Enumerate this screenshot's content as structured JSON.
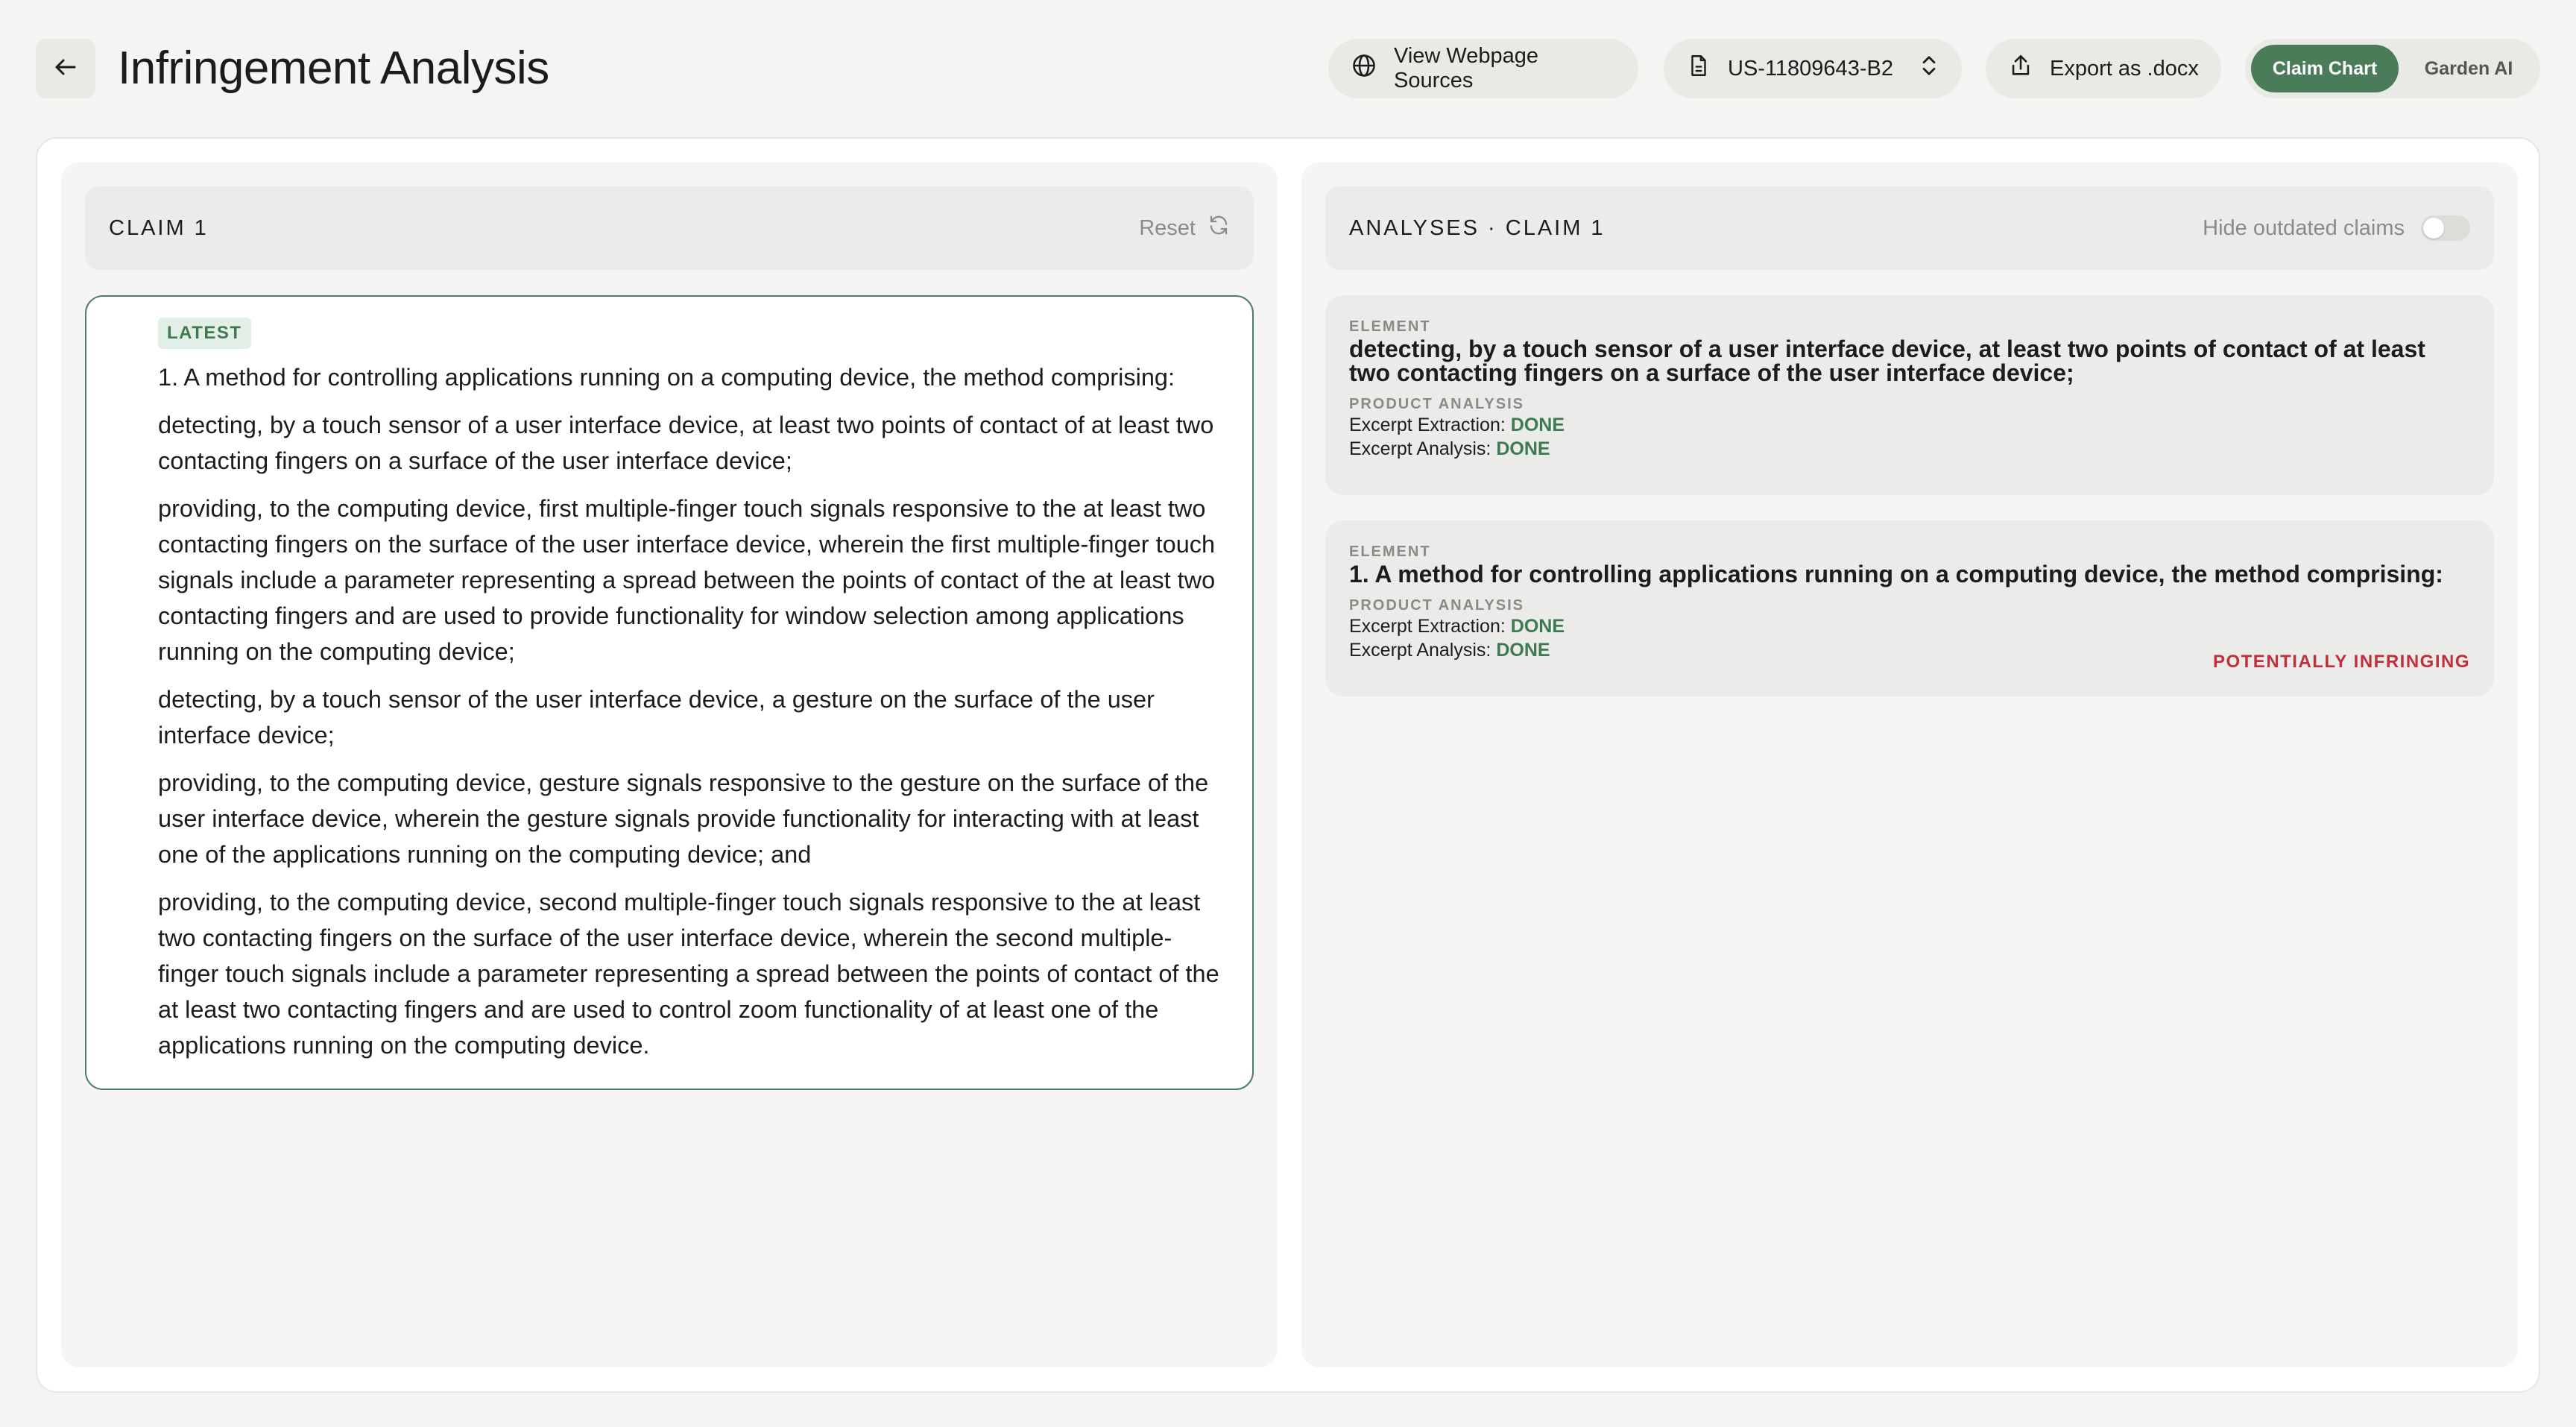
{
  "header": {
    "title": "Infringement Analysis",
    "view_sources_label": "View Webpage Sources",
    "patent_number": "US-11809643-B2",
    "export_label": "Export as .docx",
    "tabs": [
      {
        "label": "Claim Chart",
        "active": true
      },
      {
        "label": "Garden AI",
        "active": false
      }
    ]
  },
  "claim_panel": {
    "title": "CLAIM 1",
    "reset_label": "Reset",
    "badge": "LATEST",
    "paragraphs": [
      "1. A method for controlling applications running on a computing device, the method comprising:",
      "detecting, by a touch sensor of a user interface device, at least two points of contact of at least two contacting fingers on a surface of the user interface device;",
      "providing, to the computing device, first multiple-finger touch signals responsive to the at least two contacting fingers on the surface of the user interface device, wherein the first multiple-finger touch signals include a parameter representing a spread between the points of contact of the at least two contacting fingers and are used to provide functionality for window selection among applications running on the computing device;",
      "detecting, by a touch sensor of the user interface device, a gesture on the surface of the user interface device;",
      "providing, to the computing device, gesture signals responsive to the gesture on the surface of the user interface device, wherein the gesture signals provide functionality for interacting with at least one of the applications running on the computing device; and",
      "providing, to the computing device, second multiple-finger touch signals responsive to the at least two contacting fingers on the surface of the user interface device, wherein the second multiple-finger touch signals include a parameter representing a spread between the points of contact of the at least two contacting fingers and are used to control zoom functionality of at least one of the applications running on the computing device."
    ]
  },
  "analyses_panel": {
    "title": "ANALYSES · CLAIM 1",
    "hide_outdated_label": "Hide outdated claims",
    "hide_outdated_on": false,
    "elements": [
      {
        "kicker": "ELEMENT",
        "text": "detecting, by a touch sensor of a user interface device, at least two points of contact of at least two contacting fingers on a surface of the user interface device;",
        "analysis_kicker": "PRODUCT ANALYSIS",
        "extraction_label": "Excerpt Extraction:",
        "extraction_status": "DONE",
        "analysis_label": "Excerpt Analysis:",
        "analysis_status": "DONE",
        "verdict": ""
      },
      {
        "kicker": "ELEMENT",
        "text": "1. A method for controlling applications running on a computing device, the method comprising:",
        "analysis_kicker": "PRODUCT ANALYSIS",
        "extraction_label": "Excerpt Extraction:",
        "extraction_status": "DONE",
        "analysis_label": "Excerpt Analysis:",
        "analysis_status": "DONE",
        "verdict": "POTENTIALLY INFRINGING"
      }
    ]
  },
  "colors": {
    "accent": "#4a7c59",
    "done": "#3d7a52",
    "infringing": "#c0303c",
    "card_border": "#4d7d6b"
  },
  "icons": {
    "back": "arrow-left-icon",
    "sources": "globe-icon",
    "patent": "document-icon",
    "patent_select": "chevron-up-down-icon",
    "export": "share-upload-icon",
    "reset": "refresh-icon"
  }
}
